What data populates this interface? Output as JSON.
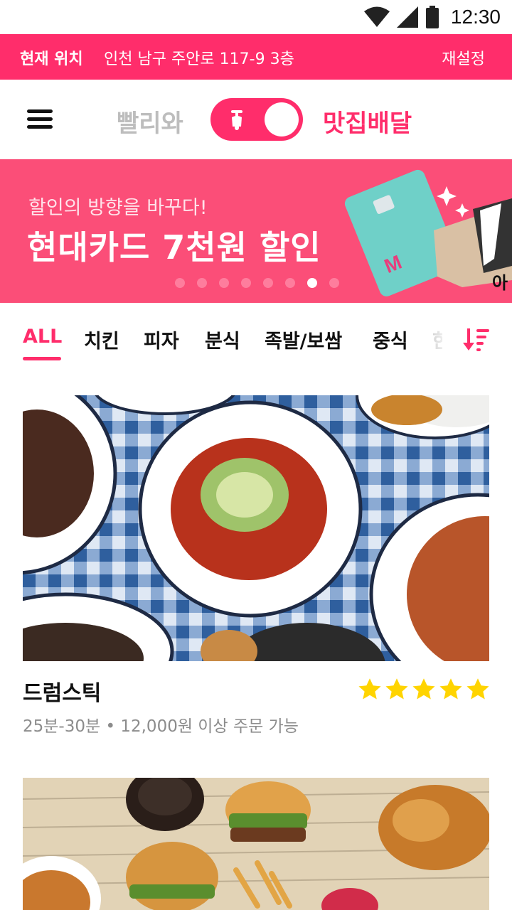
{
  "status_bar": {
    "time": "12:30",
    "icons": [
      "wifi-icon",
      "signal-icon",
      "battery-icon"
    ]
  },
  "location": {
    "label": "현재 위치",
    "address": "인천 남구 주안로 117-9 3층",
    "reset_label": "재설정"
  },
  "header": {
    "menu_icon": "hamburger-menu-icon",
    "mode_left": "빨리와",
    "mode_right": "맛집배달",
    "toggle_icon": "scooter-icon",
    "toggle_on": true
  },
  "banner": {
    "subtitle": "할인의 방향을 바꾸다!",
    "title": "현대카드 7천원 할인",
    "cut_text": "아",
    "dot_count": 8,
    "active_dot": 7
  },
  "categories": {
    "items": [
      "ALL",
      "치킨",
      "피자",
      "분식",
      "족발/보쌈",
      "중식",
      "한"
    ],
    "active_index": 0,
    "sort_icon": "sort-descending-icon"
  },
  "restaurants": [
    {
      "name": "드럼스틱",
      "delivery_time": "25분-30분",
      "separator": "•",
      "min_order": "12,000원 이상 주문 가능",
      "rating_stars": 5
    }
  ],
  "colors": {
    "brand": "#ff2d6b",
    "banner": "#fb4e78",
    "star": "#ffd400",
    "muted": "#bdbdbd"
  }
}
